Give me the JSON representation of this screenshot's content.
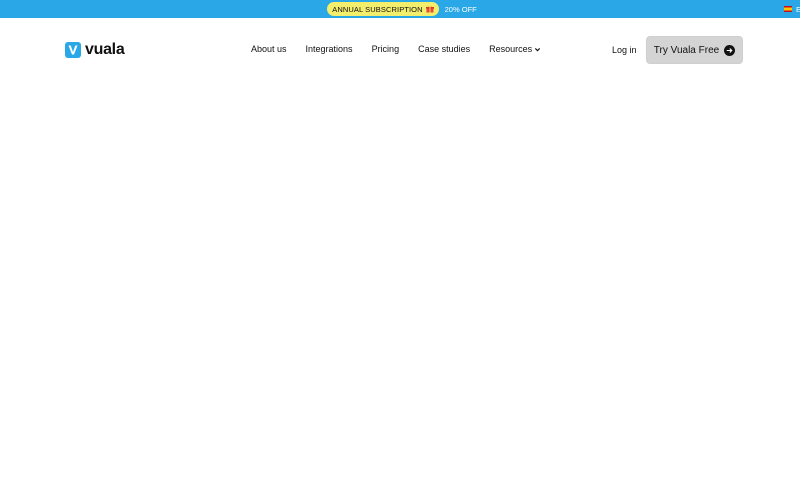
{
  "promo": {
    "badge_label": "ANNUAL SUBSCRIPTION",
    "badge_icon": "gift-icon",
    "discount_text": "20% OFF",
    "bar_color": "#2aa7e6",
    "badge_color": "#f3ee6c"
  },
  "language": {
    "code": "ES",
    "flag_icon": "spain-flag-icon"
  },
  "header": {
    "logo_text": "vuala",
    "logo_color": "#2aa7e6",
    "nav": [
      {
        "label": "About us"
      },
      {
        "label": "Integrations"
      },
      {
        "label": "Pricing"
      },
      {
        "label": "Case studies"
      },
      {
        "label": "Resources",
        "icon": "chevron-down-icon"
      }
    ],
    "login_label": "Log in",
    "cta_label": "Try Vuala Free",
    "cta_icon": "arrow-right-circle-icon"
  }
}
